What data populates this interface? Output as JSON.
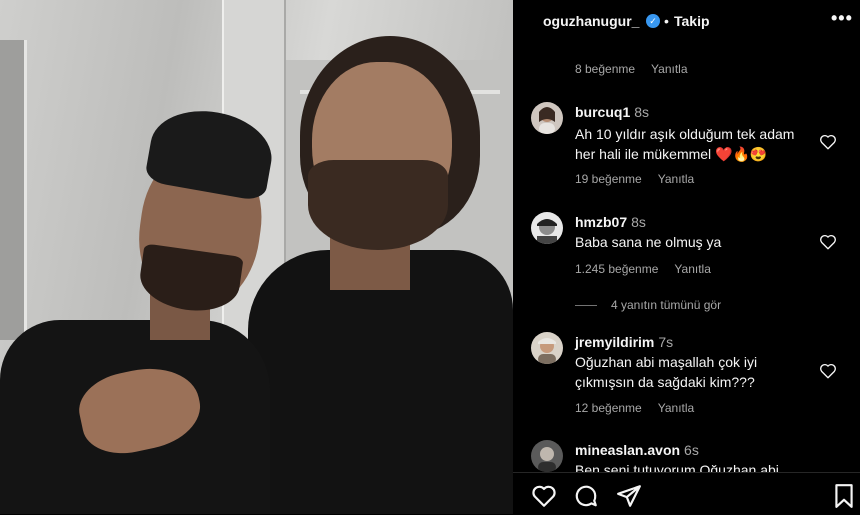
{
  "header": {
    "username": "oguzhanugur_",
    "verified_icon": "verified-badge-icon",
    "separator": "•",
    "follow_label": "Takip",
    "more_label": "•••"
  },
  "top_meta": {
    "likes": "8 beğenme",
    "reply": "Yanıtla"
  },
  "comments": [
    {
      "username": "burcuq1",
      "time": "8s",
      "text_line1": "Ah 10 yıldır aşık olduğum tek adam",
      "text_line2": "her hali ile mükemmel ❤️🔥😍",
      "likes": "19 beğenme",
      "reply": "Yanıtla"
    },
    {
      "username": "hmzb07",
      "time": "8s",
      "text_line1": "Baba sana ne olmuş ya",
      "likes": "1.245 beğenme",
      "reply": "Yanıtla",
      "view_replies": "4 yanıtın tümünü gör"
    },
    {
      "username": "jremyildirim",
      "time": "7s",
      "text_line1": "Oğuzhan abi maşallah çok iyi",
      "text_line2": "çıkmışsın da sağdaki kim???",
      "likes": "12 beğenme",
      "reply": "Yanıtla"
    },
    {
      "username": "mineaslan.avon",
      "time": "6s",
      "text_line1": "Ben seni tutuyorum Oğuzhan abi"
    }
  ],
  "icons": [
    "heart-icon",
    "comment-icon",
    "share-icon",
    "bookmark-icon",
    "more-icon"
  ],
  "colors": {
    "background": "#000000",
    "text": "#f5f5f5",
    "muted": "#a8a8a8",
    "verified": "#3897f0"
  }
}
